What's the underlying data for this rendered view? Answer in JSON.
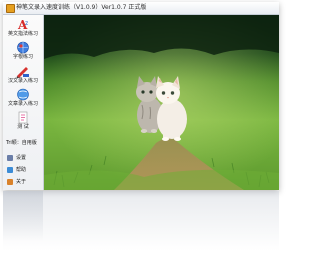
{
  "window": {
    "title": "神笔文录入速度训练（V1.0.9）Ver1.0.7 正式版"
  },
  "sidebar": {
    "items": [
      {
        "label": "英文指法练习",
        "icon": "letter-a-icon"
      },
      {
        "label": "字根练习",
        "icon": "globe-icon"
      },
      {
        "label": "汉文录入练习",
        "icon": "pen-icon"
      },
      {
        "label": "文章录入练习",
        "icon": "document-globe-icon"
      },
      {
        "label": "测 试",
        "icon": "test-icon"
      }
    ],
    "user_label": "Tri颖：自用版",
    "bottom_items": [
      {
        "label": "设置",
        "icon": "settings-icon"
      },
      {
        "label": "帮助",
        "icon": "help-icon"
      },
      {
        "label": "关于",
        "icon": "about-icon"
      }
    ]
  },
  "colors": {
    "grass": "#6aa338",
    "path": "#b58a55",
    "sky_dark": "#18301a"
  }
}
